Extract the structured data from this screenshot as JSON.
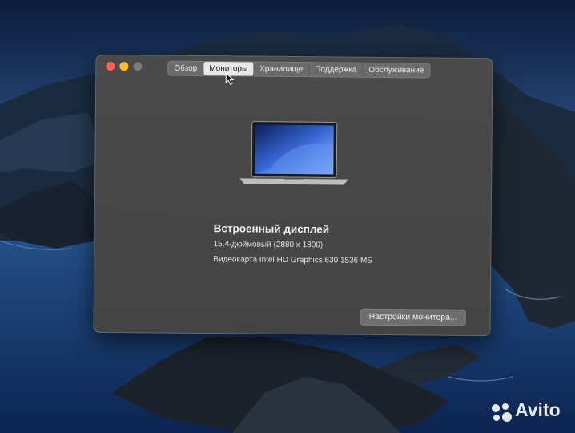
{
  "window": {
    "tabs": [
      {
        "label": "Обзор",
        "selected": false
      },
      {
        "label": "Мониторы",
        "selected": true
      },
      {
        "label": "Хранилище",
        "selected": false
      },
      {
        "label": "Поддержка",
        "selected": false
      },
      {
        "label": "Обслуживание",
        "selected": false
      }
    ]
  },
  "display": {
    "name": "Встроенный дисплей",
    "size_resolution": "15,4-дюймовый (2880 x 1800)",
    "graphics": "Видеокарта Intel HD Graphics 630 1536 МБ",
    "settings_button": "Настройки монитора..."
  },
  "watermark": {
    "text": "Avito"
  },
  "colors": {
    "close": "#ff5f57",
    "minimize": "#febc2e",
    "window_bg": "#474747"
  }
}
